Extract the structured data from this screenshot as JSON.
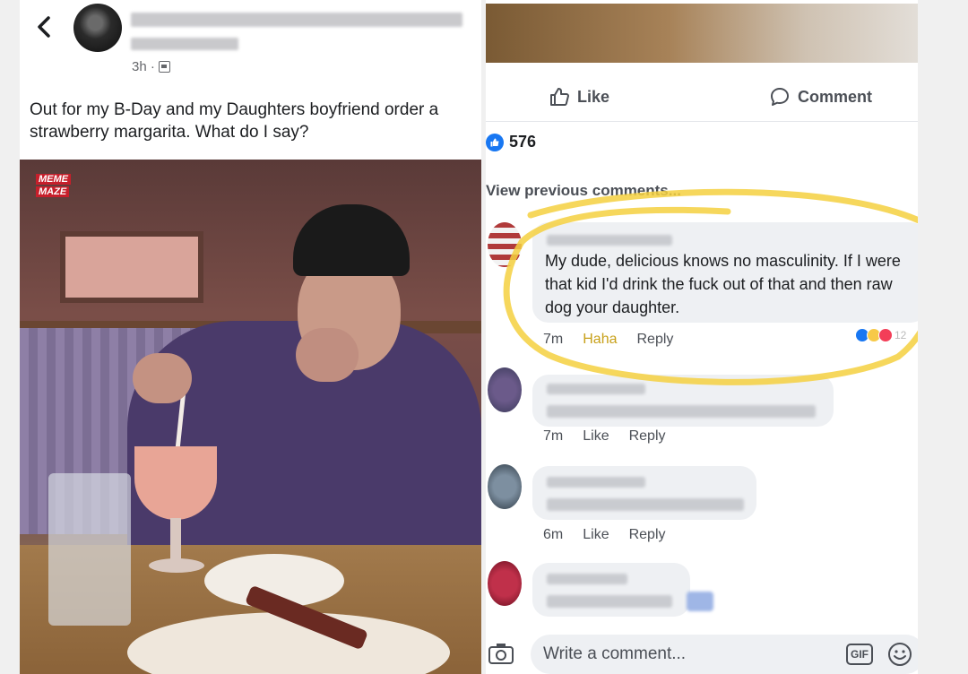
{
  "post": {
    "time": "3h ·",
    "text": "Out for my B-Day and my Daughters boyfriend order a strawberry margarita. What do I say?",
    "watermark": [
      "MEME",
      "MAZE"
    ]
  },
  "actions": {
    "like_label": "Like",
    "comment_label": "Comment"
  },
  "reactions": {
    "count": "576"
  },
  "comments_header": {
    "view_previous": "View previous comments..."
  },
  "comments": [
    {
      "text": "My dude, delicious knows no masculinity. If I were that kid I'd drink the fuck out of that and then raw dog your daughter.",
      "time": "7m",
      "reaction_label": "Haha",
      "reply_label": "Reply",
      "reaction_count": "12"
    },
    {
      "time": "7m",
      "like_label": "Like",
      "reply_label": "Reply"
    },
    {
      "time": "6m",
      "like_label": "Like",
      "reply_label": "Reply"
    },
    {}
  ],
  "composer": {
    "placeholder": "Write a comment...",
    "gif_label": "GIF"
  },
  "colors": {
    "accent": "#1877f2",
    "highlight": "#f4d03f",
    "haha": "#c8a11a"
  },
  "icons": [
    "back-arrow-icon",
    "globe-icon",
    "like-icon",
    "comment-icon",
    "camera-icon",
    "gif-icon",
    "emoji-icon"
  ]
}
